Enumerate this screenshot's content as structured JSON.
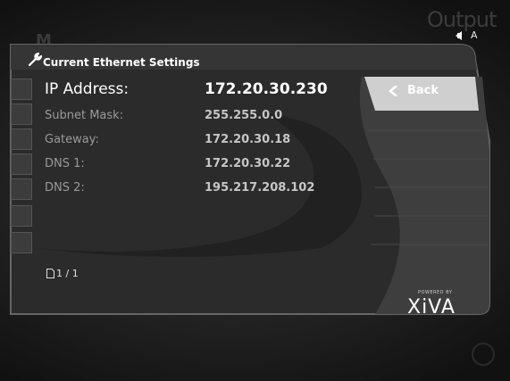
{
  "header": {
    "background_title": "M",
    "output_label": "Output",
    "status_letter": "A"
  },
  "panel": {
    "title": "Current Ethernet Settings",
    "rows": [
      {
        "label": "IP Address:",
        "value": "172.20.30.230"
      },
      {
        "label": "Subnet Mask:",
        "value": "255.255.0.0"
      },
      {
        "label": "Gateway:",
        "value": "172.20.30.18"
      },
      {
        "label": "DNS 1:",
        "value": "172.20.30.22"
      },
      {
        "label": "DNS 2:",
        "value": "195.217.208.102"
      }
    ],
    "back_label": "Back",
    "page_indicator": "1 / 1"
  },
  "brand": {
    "powered_by": "POWERED BY",
    "name": "XiVA"
  },
  "icons": {
    "wrench": "wrench-icon",
    "back": "chevron-left-icon",
    "page": "page-icon",
    "speaker": "speaker-icon"
  }
}
